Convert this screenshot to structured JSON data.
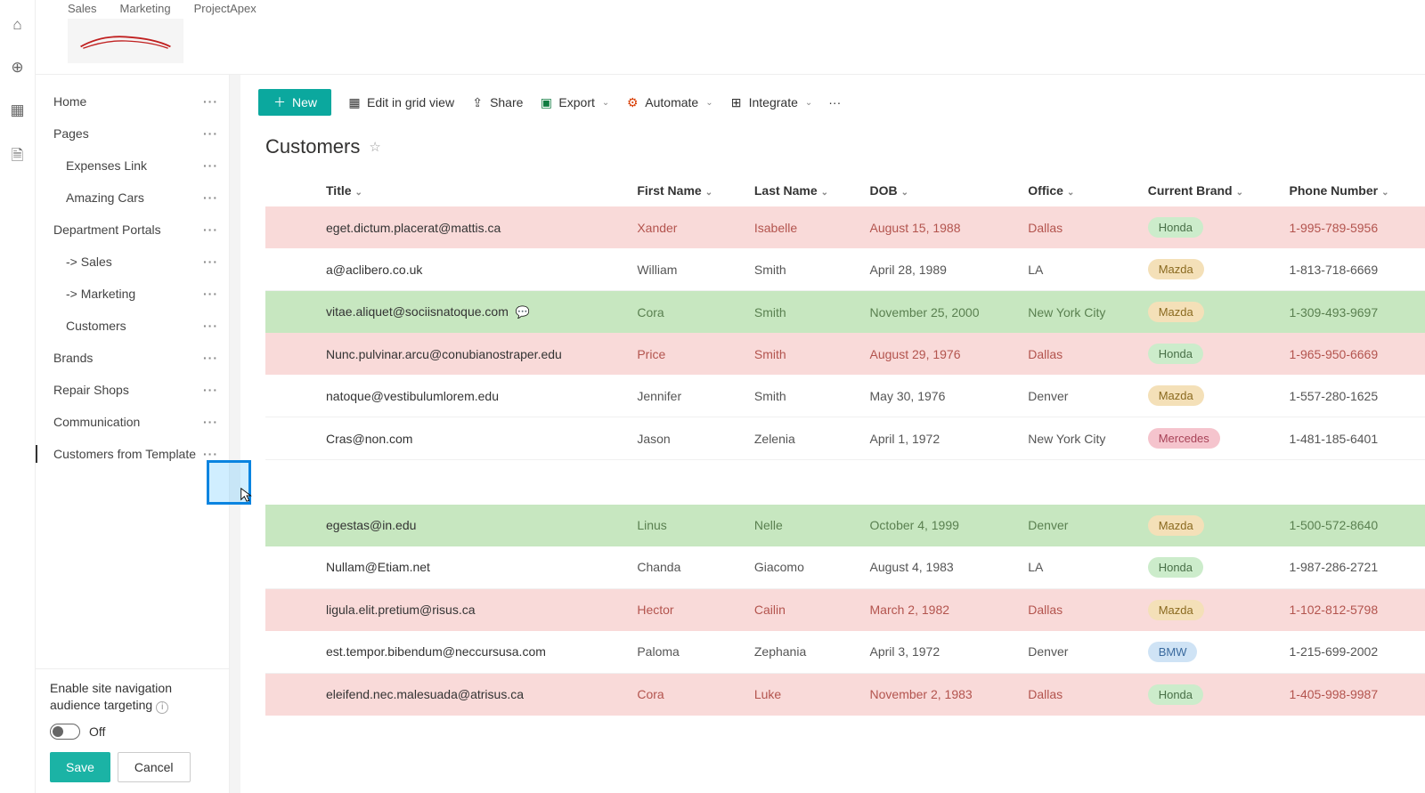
{
  "topTabs": [
    "Sales",
    "Marketing",
    "ProjectApex"
  ],
  "nav": {
    "items": [
      {
        "label": "Home",
        "indent": 0
      },
      {
        "label": "Pages",
        "indent": 0
      },
      {
        "label": "Expenses Link",
        "indent": 1
      },
      {
        "label": "Amazing Cars",
        "indent": 1
      },
      {
        "label": "Department Portals",
        "indent": 0
      },
      {
        "label": "-> Sales",
        "indent": 1
      },
      {
        "label": "-> Marketing",
        "indent": 1
      },
      {
        "label": "Customers",
        "indent": 1
      },
      {
        "label": "Brands",
        "indent": 0
      },
      {
        "label": "Repair Shops",
        "indent": 0
      },
      {
        "label": "Communication",
        "indent": 0
      },
      {
        "label": "Customers from Template",
        "indent": 0,
        "selected": true
      }
    ],
    "audience": {
      "label": "Enable site navigation audience targeting",
      "state": "Off",
      "save": "Save",
      "cancel": "Cancel"
    }
  },
  "cmdbar": {
    "new": "New",
    "edit": "Edit in grid view",
    "share": "Share",
    "export": "Export",
    "automate": "Automate",
    "integrate": "Integrate"
  },
  "list": {
    "title": "Customers",
    "columns": [
      "Title",
      "First Name",
      "Last Name",
      "DOB",
      "Office",
      "Current Brand",
      "Phone Number"
    ],
    "rows": [
      {
        "style": "pink",
        "title": "eget.dictum.placerat@mattis.ca",
        "first": "Xander",
        "last": "Isabelle",
        "dob": "August 15, 1988",
        "office": "Dallas",
        "brand": "Honda",
        "phone": "1-995-789-5956"
      },
      {
        "style": "plain",
        "title": "a@aclibero.co.uk",
        "first": "William",
        "last": "Smith",
        "dob": "April 28, 1989",
        "office": "LA",
        "brand": "Mazda",
        "phone": "1-813-718-6669"
      },
      {
        "style": "green",
        "title": "vitae.aliquet@sociisnatoque.com",
        "first": "Cora",
        "last": "Smith",
        "dob": "November 25, 2000",
        "office": "New York City",
        "brand": "Mazda",
        "phone": "1-309-493-9697",
        "comment": true
      },
      {
        "style": "pink",
        "title": "Nunc.pulvinar.arcu@conubianostraper.edu",
        "first": "Price",
        "last": "Smith",
        "dob": "August 29, 1976",
        "office": "Dallas",
        "brand": "Honda",
        "phone": "1-965-950-6669"
      },
      {
        "style": "plain",
        "title": "natoque@vestibulumlorem.edu",
        "first": "Jennifer",
        "last": "Smith",
        "dob": "May 30, 1976",
        "office": "Denver",
        "brand": "Mazda",
        "phone": "1-557-280-1625"
      },
      {
        "style": "plain",
        "title": "Cras@non.com",
        "first": "Jason",
        "last": "Zelenia",
        "dob": "April 1, 1972",
        "office": "New York City",
        "brand": "Mercedes",
        "phone": "1-481-185-6401"
      },
      {
        "gap": true
      },
      {
        "style": "green",
        "title": "egestas@in.edu",
        "first": "Linus",
        "last": "Nelle",
        "dob": "October 4, 1999",
        "office": "Denver",
        "brand": "Mazda",
        "phone": "1-500-572-8640"
      },
      {
        "style": "plain",
        "title": "Nullam@Etiam.net",
        "first": "Chanda",
        "last": "Giacomo",
        "dob": "August 4, 1983",
        "office": "LA",
        "brand": "Honda",
        "phone": "1-987-286-2721"
      },
      {
        "style": "pink",
        "title": "ligula.elit.pretium@risus.ca",
        "first": "Hector",
        "last": "Cailin",
        "dob": "March 2, 1982",
        "office": "Dallas",
        "brand": "Mazda",
        "phone": "1-102-812-5798"
      },
      {
        "style": "plain",
        "title": "est.tempor.bibendum@neccursusa.com",
        "first": "Paloma",
        "last": "Zephania",
        "dob": "April 3, 1972",
        "office": "Denver",
        "brand": "BMW",
        "phone": "1-215-699-2002"
      },
      {
        "style": "pink",
        "title": "eleifend.nec.malesuada@atrisus.ca",
        "first": "Cora",
        "last": "Luke",
        "dob": "November 2, 1983",
        "office": "Dallas",
        "brand": "Honda",
        "phone": "1-405-998-9987"
      }
    ]
  }
}
